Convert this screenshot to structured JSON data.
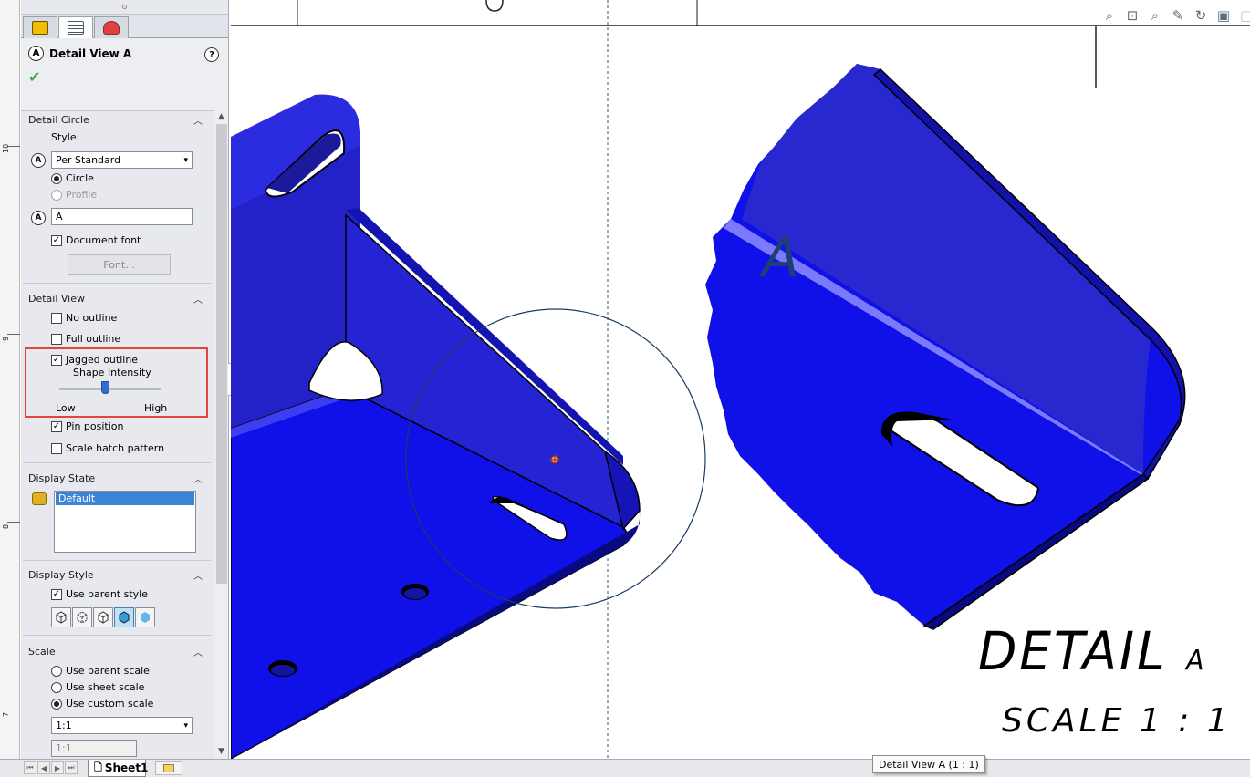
{
  "ruler": {
    "labels": [
      "10",
      "9",
      "8",
      "7"
    ]
  },
  "panel": {
    "title": "Detail View A",
    "callout_letter": "A",
    "help": "?",
    "detail_circle": {
      "header": "Detail Circle",
      "style_label": "Style:",
      "style_value": "Per Standard",
      "circle_label": "Circle",
      "profile_label": "Profile",
      "label_value": "A",
      "document_font": "Document font",
      "font_button": "Font..."
    },
    "detail_view": {
      "header": "Detail View",
      "no_outline": "No outline",
      "full_outline": "Full outline",
      "jagged_outline": "Jagged outline",
      "shape_intensity": "Shape Intensity",
      "low": "Low",
      "high": "High",
      "intensity_level": 0.45,
      "pin_position": "Pin position",
      "scale_hatch": "Scale hatch pattern"
    },
    "display_state": {
      "header": "Display State",
      "selected": "Default"
    },
    "display_style": {
      "header": "Display Style",
      "use_parent": "Use parent style"
    },
    "scale": {
      "header": "Scale",
      "use_parent_scale": "Use parent scale",
      "use_sheet_scale": "Use sheet scale",
      "use_custom_scale": "Use custom scale",
      "custom_value": "1:1",
      "custom_field": "1:1"
    }
  },
  "canvas": {
    "view_letter": "A",
    "detail_title": "DETAIL",
    "detail_letter": "A",
    "detail_scale": "SCALE 1 : 1",
    "tooltip": "Detail View A (1 : 1)",
    "part_color": "#1010e8",
    "part_shade": "#2a2ad0"
  },
  "sheet_tab": "Sheet1"
}
